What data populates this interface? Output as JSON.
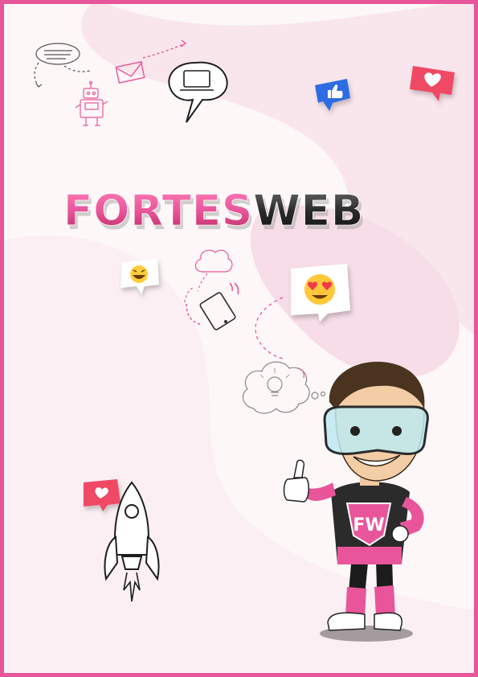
{
  "brand": {
    "wordmark_part1": "FORTES",
    "wordmark_part2": "WEB",
    "badge_text": "FW"
  },
  "colors": {
    "accent": "#e8559a",
    "accent_dark": "#c62f6e",
    "bg": "#fdf7f8",
    "blob": "#f8e2ea",
    "ink": "#2b2b2b",
    "like_blue": "#2d6ce3",
    "heart_red": "#ef4965"
  },
  "icons": [
    "chat-bubble-icon",
    "envelope-icon",
    "robot-icon",
    "laptop-bubble-icon",
    "thumbs-up-icon",
    "heart-bubble-icon",
    "laughing-emoji-icon",
    "heart-eyes-emoji-icon",
    "cloud-icon",
    "tablet-icon",
    "lightbulb-cloud-icon",
    "rocket-icon",
    "mascot-icon"
  ]
}
